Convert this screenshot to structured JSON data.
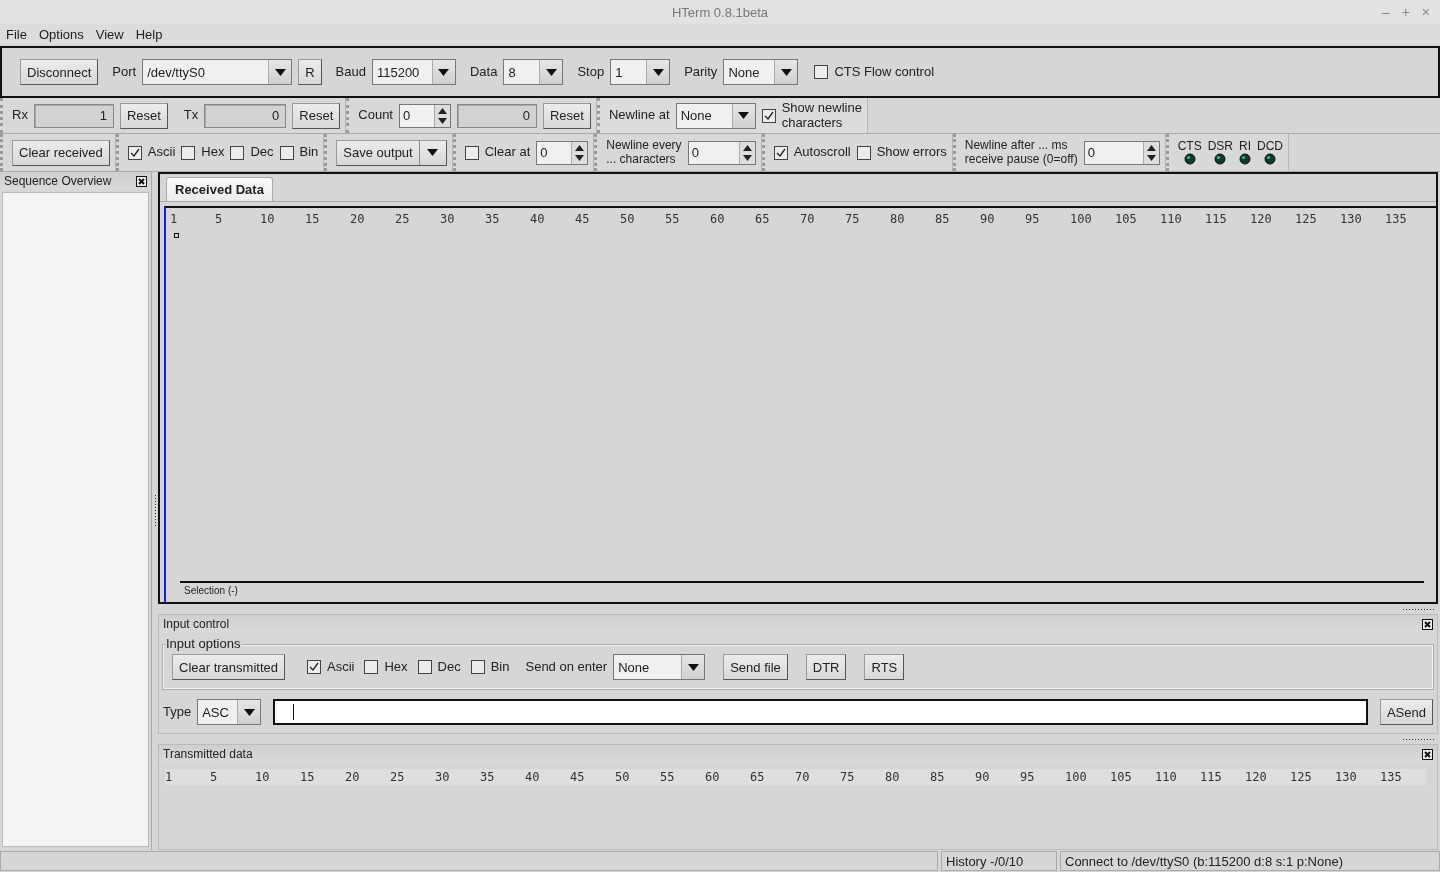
{
  "window": {
    "title": "HTerm 0.8.1beta",
    "controls": [
      "–",
      "+",
      "×"
    ]
  },
  "menu": [
    "File",
    "Options",
    "View",
    "Help"
  ],
  "connection_bar": [
    {
      "kind": "button",
      "label": "Disconnect"
    },
    {
      "kind": "label",
      "text": "Port"
    },
    {
      "kind": "combo",
      "value": "/dev/ttyS0"
    },
    {
      "kind": "button",
      "label": "R"
    },
    {
      "kind": "label",
      "text": "Baud"
    },
    {
      "kind": "combo",
      "value": "115200"
    },
    {
      "kind": "label",
      "text": "Data"
    },
    {
      "kind": "combo",
      "value": "8"
    },
    {
      "kind": "label",
      "text": "Stop"
    },
    {
      "kind": "combo",
      "value": "1"
    },
    {
      "kind": "label",
      "text": "Parity"
    },
    {
      "kind": "combo",
      "value": "None"
    },
    {
      "kind": "check",
      "label": "CTS Flow control",
      "checked": false
    }
  ],
  "toolbar_rows": [
    [
      [
        {
          "kind": "label",
          "text": "Rx"
        },
        {
          "kind": "field",
          "value": "1"
        },
        {
          "kind": "button",
          "label": "Reset"
        },
        {
          "kind": "label",
          "text": "Tx"
        },
        {
          "kind": "field",
          "value": "0"
        },
        {
          "kind": "button",
          "label": "Reset"
        }
      ],
      [
        {
          "kind": "label",
          "text": "Count"
        },
        {
          "kind": "spin",
          "value": "0"
        },
        {
          "kind": "field",
          "value": "0"
        },
        {
          "kind": "button",
          "label": "Reset"
        }
      ],
      [
        {
          "kind": "label",
          "text": "Newline at"
        },
        {
          "kind": "combo",
          "value": "None"
        },
        {
          "kind": "check",
          "label": "Show newline\ncharacters",
          "checked": true
        }
      ]
    ],
    [
      [
        {
          "kind": "button",
          "label": "Clear received"
        }
      ],
      [
        {
          "kind": "check",
          "label": "Ascii",
          "checked": true
        },
        {
          "kind": "check",
          "label": "Hex",
          "checked": false
        },
        {
          "kind": "check",
          "label": "Dec",
          "checked": false
        },
        {
          "kind": "check",
          "label": "Bin",
          "checked": false
        }
      ],
      [
        {
          "kind": "split_button",
          "label": "Save output"
        }
      ],
      [
        {
          "kind": "check",
          "label": "Clear at",
          "checked": false
        },
        {
          "kind": "spin",
          "value": "0"
        }
      ],
      [
        {
          "kind": "label",
          "text": "Newline every\n... characters"
        },
        {
          "kind": "spin",
          "value": "0"
        }
      ],
      [
        {
          "kind": "check",
          "label": "Autoscroll",
          "checked": true
        },
        {
          "kind": "check",
          "label": "Show errors",
          "checked": false
        }
      ],
      [
        {
          "kind": "label",
          "text": "Newline after ... ms\nreceive pause (0=off)"
        },
        {
          "kind": "spin",
          "value": "0"
        }
      ],
      [
        {
          "kind": "led",
          "label": "CTS"
        },
        {
          "kind": "led",
          "label": "DSR"
        },
        {
          "kind": "led",
          "label": "RI"
        },
        {
          "kind": "led",
          "label": "DCD"
        }
      ]
    ]
  ],
  "sequence_overview": {
    "title": "Sequence Overview"
  },
  "received": {
    "tabs": [
      {
        "label": "Received Data",
        "selected": true
      }
    ],
    "ruler": [
      "1",
      "5",
      "10",
      "15",
      "20",
      "25",
      "30",
      "35",
      "40",
      "45",
      "50",
      "55",
      "60",
      "65",
      "70",
      "75",
      "80",
      "85",
      "90",
      "95",
      "100",
      "105",
      "110",
      "115",
      "120",
      "125",
      "130",
      "135"
    ],
    "selection": "Selection (-)"
  },
  "input_control": {
    "title": "Input control",
    "options_title": "Input options",
    "options": [
      {
        "kind": "button",
        "label": "Clear transmitted"
      },
      {
        "kind": "check",
        "label": "Ascii",
        "checked": true
      },
      {
        "kind": "check",
        "label": "Hex",
        "checked": false
      },
      {
        "kind": "check",
        "label": "Dec",
        "checked": false
      },
      {
        "kind": "check",
        "label": "Bin",
        "checked": false
      },
      {
        "kind": "label",
        "text": "Send on enter"
      },
      {
        "kind": "combo",
        "value": "None"
      },
      {
        "kind": "button",
        "label": "Send file"
      },
      {
        "kind": "button",
        "label": "DTR"
      },
      {
        "kind": "button",
        "label": "RTS"
      }
    ],
    "input_row": [
      {
        "kind": "label",
        "text": "Type"
      },
      {
        "kind": "combo",
        "value": "ASC"
      },
      {
        "kind": "text_input"
      },
      {
        "kind": "button",
        "label": "ASend"
      }
    ]
  },
  "transmitted": {
    "title": "Transmitted data",
    "ruler": [
      "1",
      "5",
      "10",
      "15",
      "20",
      "25",
      "30",
      "35",
      "40",
      "45",
      "50",
      "55",
      "60",
      "65",
      "70",
      "75",
      "80",
      "85",
      "90",
      "95",
      "100",
      "105",
      "110",
      "115",
      "120",
      "125",
      "130",
      "135"
    ]
  },
  "status_bar": {
    "history": "History -/0/10",
    "message": "Connect to /dev/ttyS0 (b:115200 d:8 s:1 p:None)"
  }
}
